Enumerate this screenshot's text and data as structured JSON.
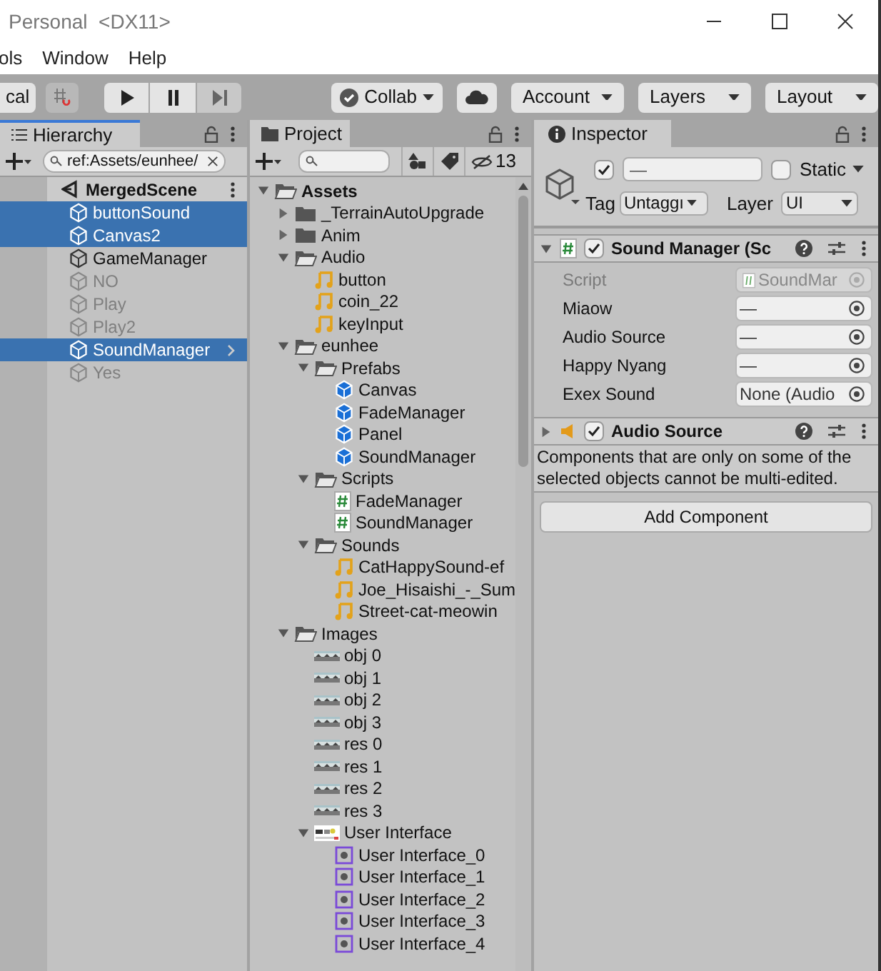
{
  "window": {
    "title": "Personal  <DX11>"
  },
  "menu": [
    "ols",
    "Window",
    "Help"
  ],
  "toolbar": {
    "left_button": "cal",
    "collab": "Collab",
    "account": "Account",
    "layers": "Layers",
    "layout": "Layout"
  },
  "hierarchy": {
    "tab": "Hierarchy",
    "search": "ref:Assets/eunhee/",
    "scene": "MergedScene",
    "items": [
      {
        "name": "buttonSound",
        "selected": true,
        "active": true,
        "has_children": false
      },
      {
        "name": "Canvas2",
        "selected": true,
        "active": true,
        "has_children": false
      },
      {
        "name": "GameManager",
        "selected": false,
        "active": true,
        "has_children": false
      },
      {
        "name": "NO",
        "selected": false,
        "active": false,
        "has_children": false
      },
      {
        "name": "Play",
        "selected": false,
        "active": false,
        "has_children": false
      },
      {
        "name": "Play2",
        "selected": false,
        "active": false,
        "has_children": false
      },
      {
        "name": "SoundManager",
        "selected": true,
        "active": true,
        "has_children": true
      },
      {
        "name": "Yes",
        "selected": false,
        "active": false,
        "has_children": false
      }
    ]
  },
  "project": {
    "tab": "Project",
    "hidden_count": "13",
    "tree": [
      {
        "kind": "folder",
        "name": "Assets",
        "bold": true,
        "expanded": true,
        "children": [
          {
            "kind": "folder",
            "name": "_TerrainAutoUpgrade",
            "expanded": false
          },
          {
            "kind": "folder",
            "name": "Anim",
            "expanded": false
          },
          {
            "kind": "folder",
            "name": "Audio",
            "expanded": true,
            "children": [
              {
                "kind": "audio",
                "name": "button"
              },
              {
                "kind": "audio",
                "name": "coin_22"
              },
              {
                "kind": "audio",
                "name": "keyInput"
              }
            ]
          },
          {
            "kind": "folder",
            "name": "eunhee",
            "expanded": true,
            "children": [
              {
                "kind": "folder",
                "name": "Prefabs",
                "expanded": true,
                "children": [
                  {
                    "kind": "prefab",
                    "name": "Canvas"
                  },
                  {
                    "kind": "prefab",
                    "name": "FadeManager"
                  },
                  {
                    "kind": "prefab",
                    "name": "Panel"
                  },
                  {
                    "kind": "prefab",
                    "name": "SoundManager"
                  }
                ]
              },
              {
                "kind": "folder",
                "name": "Scripts",
                "expanded": true,
                "children": [
                  {
                    "kind": "script",
                    "name": "FadeManager"
                  },
                  {
                    "kind": "script",
                    "name": "SoundManager"
                  }
                ]
              },
              {
                "kind": "folder",
                "name": "Sounds",
                "expanded": true,
                "children": [
                  {
                    "kind": "audio",
                    "name": "CatHappySound-ef"
                  },
                  {
                    "kind": "audio",
                    "name": "Joe_Hisaishi_-_Sum"
                  },
                  {
                    "kind": "audio",
                    "name": "Street-cat-meowin"
                  }
                ]
              }
            ]
          },
          {
            "kind": "folder",
            "name": "Images",
            "expanded": true,
            "children": [
              {
                "name": "obj 0"
              },
              {
                "name": "obj 1"
              },
              {
                "name": "obj 2"
              },
              {
                "name": "obj 3"
              },
              {
                "name": "res 0"
              },
              {
                "name": "res 1"
              },
              {
                "name": "res 2"
              },
              {
                "name": "res 3"
              },
              {
                "kind": "spritesheet",
                "name": "User Interface",
                "expanded": true,
                "children": [
                  {
                    "kind": "sprite",
                    "name": "User Interface_0"
                  },
                  {
                    "kind": "sprite",
                    "name": "User Interface_1"
                  },
                  {
                    "kind": "sprite",
                    "name": "User Interface_2"
                  },
                  {
                    "kind": "sprite",
                    "name": "User Interface_3"
                  },
                  {
                    "kind": "sprite",
                    "name": "User Interface_4"
                  }
                ]
              }
            ]
          }
        ]
      }
    ]
  },
  "inspector": {
    "tab": "Inspector",
    "active": true,
    "name": "—",
    "static": false,
    "static_label": "Static",
    "tag_label": "Tag",
    "tag": "Untaggı",
    "layer_label": "Layer",
    "layer": "UI",
    "components": [
      {
        "kind": "script",
        "title": "Sound Manager (Sc",
        "expanded": true,
        "enabled": true,
        "fields": [
          {
            "label": "Script",
            "value": "SoundMar",
            "disabled": true
          },
          {
            "label": "Miaow",
            "value": "—",
            "disabled": false
          },
          {
            "label": "Audio Source",
            "value": "—",
            "disabled": false
          },
          {
            "label": "Happy Nyang",
            "value": "—",
            "disabled": false
          },
          {
            "label": "Exex Sound",
            "value": "None (Audio",
            "disabled": false
          }
        ]
      },
      {
        "kind": "audio",
        "title": "Audio Source",
        "expanded": false,
        "enabled": true
      }
    ],
    "note": "Components that are only on some of the selected objects cannot be multi-edited.",
    "add_button": "Add Component"
  }
}
